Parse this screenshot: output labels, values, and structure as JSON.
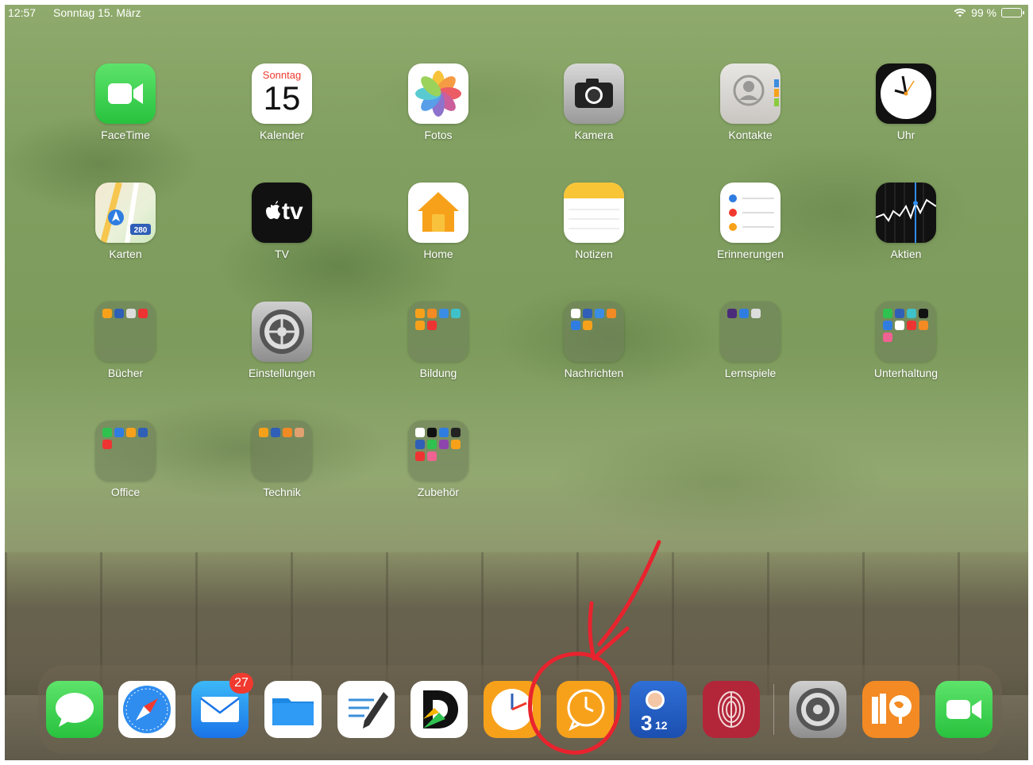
{
  "status_bar": {
    "time": "12:57",
    "date": "Sonntag 15. März",
    "battery": "99 %"
  },
  "calendar_icon": {
    "weekday": "Sonntag",
    "day": "15"
  },
  "tv_icon_text": "tv",
  "grid_apps": [
    {
      "label": "FaceTime"
    },
    {
      "label": "Kalender"
    },
    {
      "label": "Fotos"
    },
    {
      "label": "Kamera"
    },
    {
      "label": "Kontakte"
    },
    {
      "label": "Uhr"
    },
    {
      "label": "Karten"
    },
    {
      "label": "TV"
    },
    {
      "label": "Home"
    },
    {
      "label": "Notizen"
    },
    {
      "label": "Erinnerungen"
    },
    {
      "label": "Aktien"
    },
    {
      "label": "Bücher"
    },
    {
      "label": "Einstellungen"
    },
    {
      "label": "Bildung"
    },
    {
      "label": "Nachrichten"
    },
    {
      "label": "Lernspiele"
    },
    {
      "label": "Unterhaltung"
    },
    {
      "label": "Office"
    },
    {
      "label": "Technik"
    },
    {
      "label": "Zubehör"
    }
  ],
  "maps_icon_text": "280",
  "dock": {
    "mail_badge": "27",
    "apps": [
      {
        "icon": "messages-icon"
      },
      {
        "icon": "safari-icon"
      },
      {
        "icon": "mail-icon"
      },
      {
        "icon": "files-icon"
      },
      {
        "icon": "notes-pen-icon"
      },
      {
        "icon": "d-app-icon"
      },
      {
        "icon": "clock-app-icon"
      },
      {
        "icon": "speech-clock-icon"
      },
      {
        "icon": "math-app-icon"
      },
      {
        "icon": "fingerprint-app-icon"
      },
      {
        "icon": "settings-icon"
      },
      {
        "icon": "books-globe-icon"
      },
      {
        "icon": "facetime-icon"
      }
    ],
    "math_icon_text": "3",
    "math_icon_fraction": "12"
  },
  "colors": {
    "annotation": "#e8232e",
    "accent_orange": "#f5a623"
  }
}
